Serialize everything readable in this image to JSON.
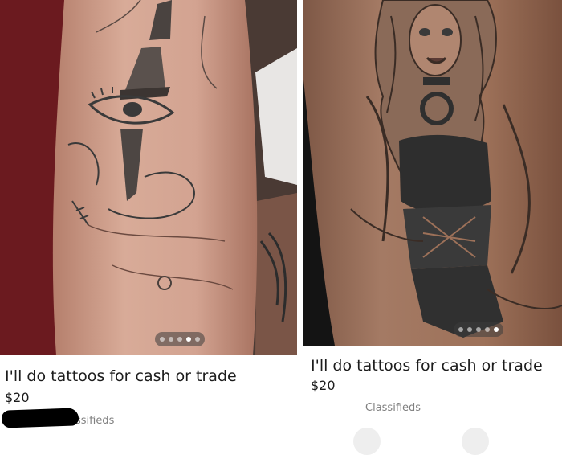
{
  "listings": [
    {
      "title": "I'll do tattoos for cash or trade",
      "price": "$20",
      "category": "assifieds",
      "photo_count": 5,
      "active_photo": 4,
      "photo_subject": "arm tattoo of an eye with pointed hat",
      "redacted": true
    },
    {
      "title": "I'll do tattoos for cash or trade",
      "price": "$20",
      "category": "Classifieds",
      "photo_count": 5,
      "active_photo": 5,
      "photo_subject": "leg tattoo of a woman in corset"
    }
  ],
  "colors": {
    "text": "#1c1c1c",
    "muted": "#808080",
    "skin": "#c99a86",
    "ink": "#3a3a3a"
  }
}
